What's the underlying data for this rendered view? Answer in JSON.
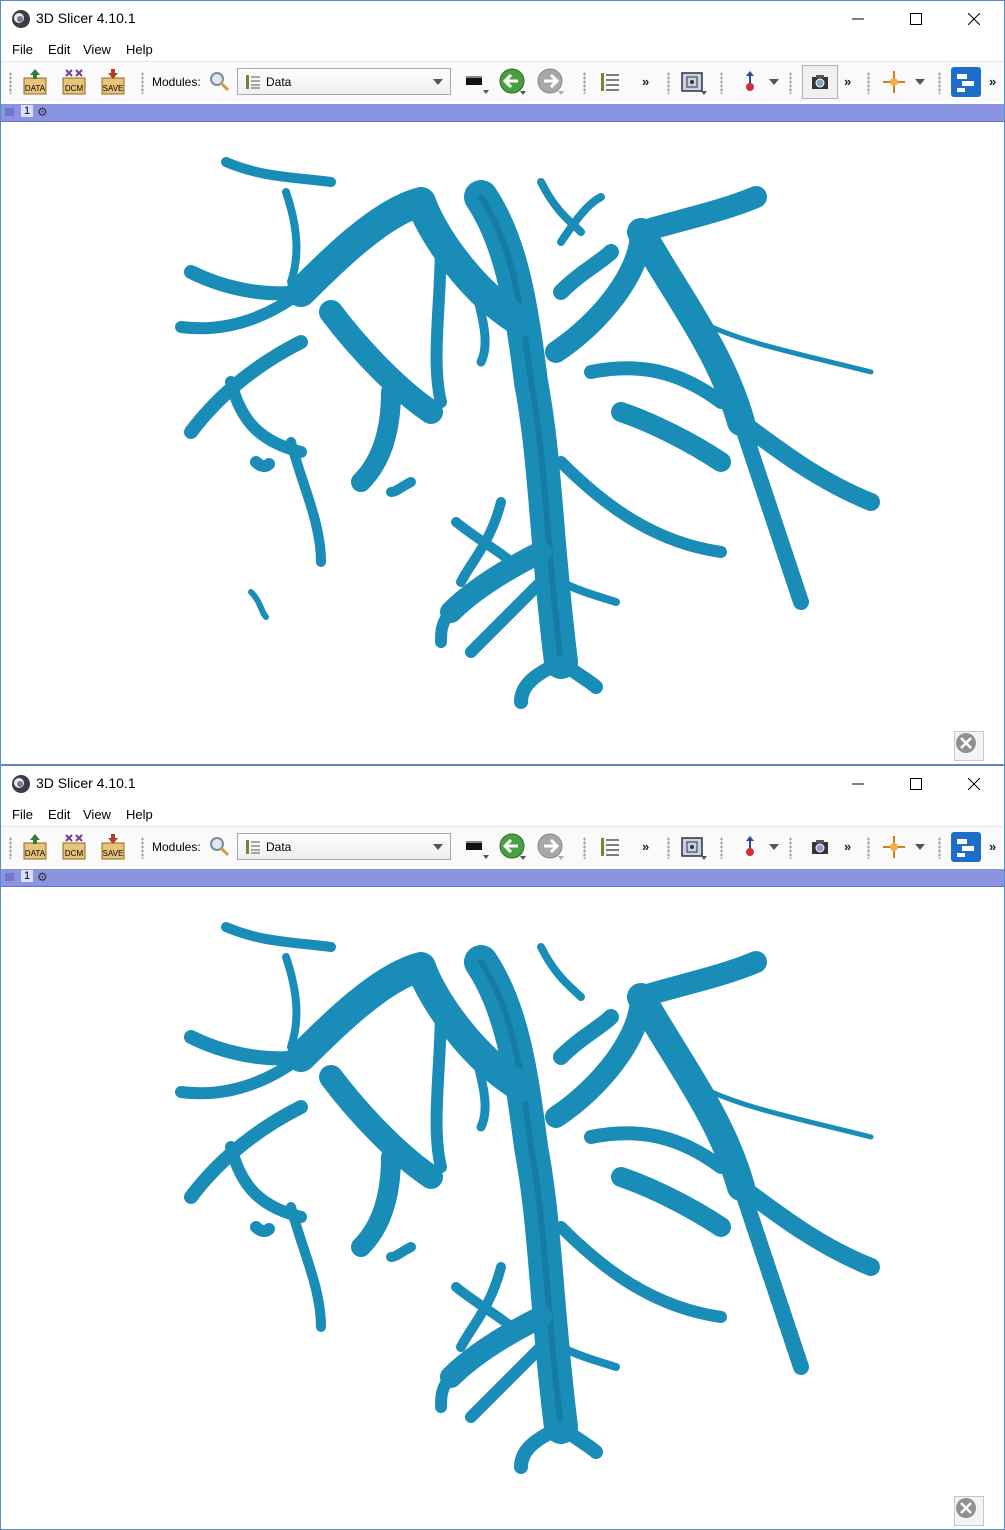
{
  "windows": [
    {
      "title": "3D Slicer 4.10.1",
      "menu": [
        "File",
        "Edit",
        "View",
        "Help"
      ],
      "toolbar": {
        "modules_label": "Modules:",
        "module_selected": "Data",
        "more": "»",
        "capture_active": true
      },
      "viewer": {
        "view_number": "1"
      }
    },
    {
      "title": "3D Slicer 4.10.1",
      "menu": [
        "File",
        "Edit",
        "View",
        "Help"
      ],
      "toolbar": {
        "modules_label": "Modules:",
        "module_selected": "Data",
        "more": "»",
        "capture_active": false
      },
      "viewer": {
        "view_number": "1"
      }
    }
  ],
  "colors": {
    "vessel": "#1a8cb8",
    "vessel_dark": "#0b5f80",
    "view_bar": "#8b94e0"
  },
  "icons": [
    "slicer-logo-icon",
    "data-load-icon",
    "dicom-icon",
    "save-icon",
    "search-icon",
    "module-list-icon",
    "layout-icon",
    "back-arrow-icon",
    "forward-arrow-icon",
    "model-tree-icon",
    "view-layout-icon",
    "mouse-mode-icon",
    "screenshot-icon",
    "crosshair-icon",
    "extension-manager-icon",
    "close-view-icon",
    "pin-icon",
    "gear-icon"
  ]
}
